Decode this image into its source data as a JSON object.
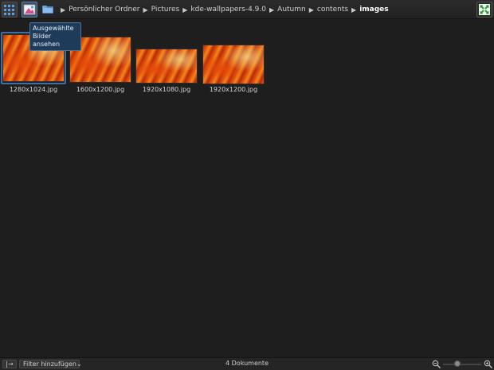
{
  "toolbar": {
    "grid_icon": "grid-view-icon",
    "viewer_icon": "image-viewer-icon",
    "close_icon": "fullscreen-close-icon"
  },
  "tooltip": {
    "text": "Ausgewählte Bilder ansehen"
  },
  "breadcrumb": {
    "home_icon": "folder-icon",
    "items": [
      "Persönlicher Ordner",
      "Pictures",
      "kde-wallpapers-4.9.0",
      "Autumn",
      "contents"
    ],
    "current": "images"
  },
  "thumbnails": [
    {
      "caption": "1280x1024.jpg",
      "selected": true
    },
    {
      "caption": "1600x1200.jpg",
      "selected": false
    },
    {
      "caption": "1920x1080.jpg",
      "selected": false
    },
    {
      "caption": "1920x1200.jpg",
      "selected": false
    }
  ],
  "statusbar": {
    "toggle_label": "|→",
    "filter_label": "Filter hinzufügen",
    "filter_arrow": "⌄",
    "count": "4 Dokumente",
    "zoom_out_icon": "zoom-out-icon",
    "zoom_in_icon": "zoom-in-icon",
    "zoom_level": 0.35
  },
  "colors": {
    "background": "#1e1e1e",
    "selection": "#3d6fa6",
    "tooltip_bg": "#1f3b5a"
  }
}
